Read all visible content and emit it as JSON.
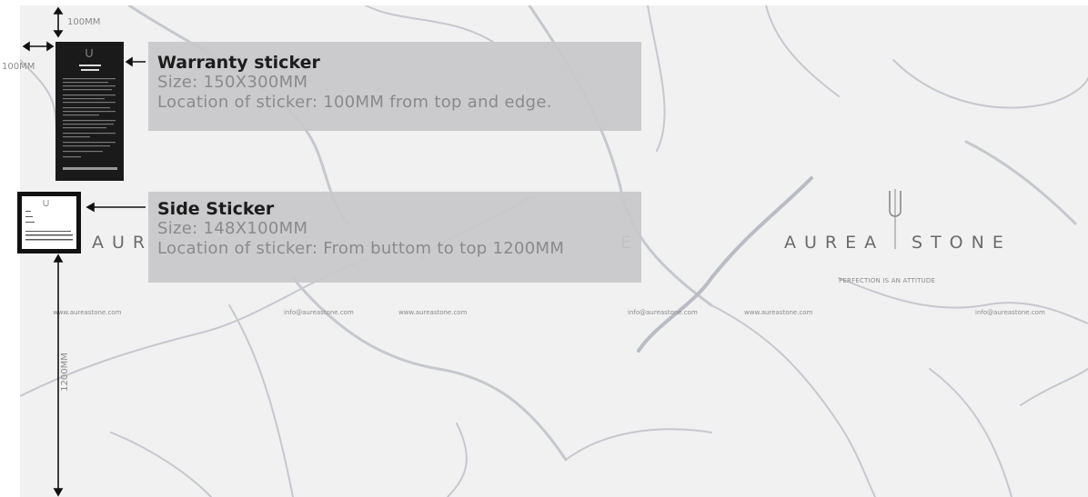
{
  "warranty_callout": {
    "title": "Warranty sticker",
    "size": "Size: 150X300MM",
    "location": "Location of sticker: 100MM from top and edge."
  },
  "side_callout": {
    "title": "Side Sticker",
    "size": "Size: 148X100MM",
    "location": "Location of sticker: From buttom to top 1200MM"
  },
  "dimensions": {
    "top_offset": "100MM",
    "edge_offset": "100MM",
    "vertical_height": "1200MM"
  },
  "slab_branding": {
    "logo_left": "AUREA",
    "logo_right": "STONE",
    "partial_left": "AUR",
    "partial_right": "E",
    "tagline": "PERFECTION IS AN ATTITUDE",
    "website": "www.aureastone.com",
    "email": "info@aureastone.com"
  },
  "colors": {
    "slab": "#f1f1f2",
    "callout_bg": "#c8c8ca",
    "callout_title": "#1c1c1c",
    "callout_text": "#8a8a8a",
    "sticker_dark": "#1a1a1a"
  }
}
